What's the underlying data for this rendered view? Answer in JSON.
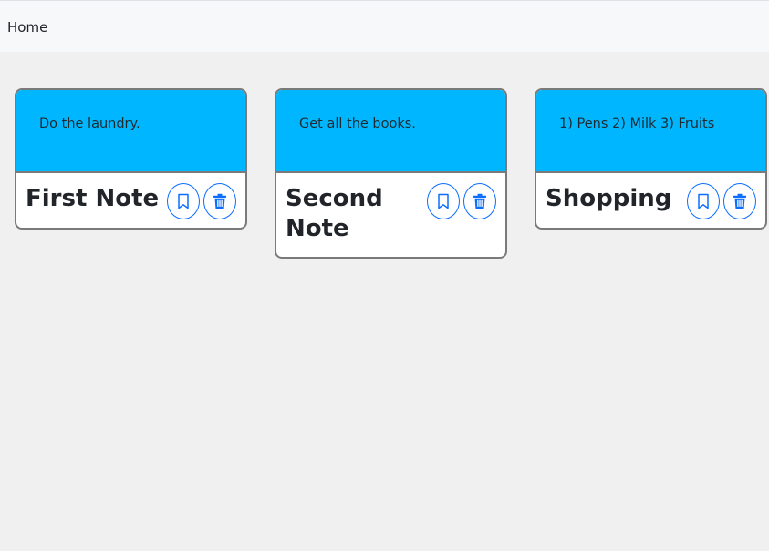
{
  "nav": {
    "home_label": "Home"
  },
  "notes": [
    {
      "title": "First Note",
      "text": "Do the laundry.",
      "bookmark_icon": "bookmark-icon",
      "delete_icon": "trash-icon"
    },
    {
      "title": "Second Note",
      "text": "Get all the books.",
      "bookmark_icon": "bookmark-icon",
      "delete_icon": "trash-icon"
    },
    {
      "title": "Shopping",
      "text": "1) Pens 2) Milk 3) Fruits",
      "bookmark_icon": "bookmark-icon",
      "delete_icon": "trash-icon"
    }
  ],
  "colors": {
    "card_header": "#00b7ff",
    "button_accent": "#0d6efd",
    "page_background": "#f0f0f0"
  }
}
